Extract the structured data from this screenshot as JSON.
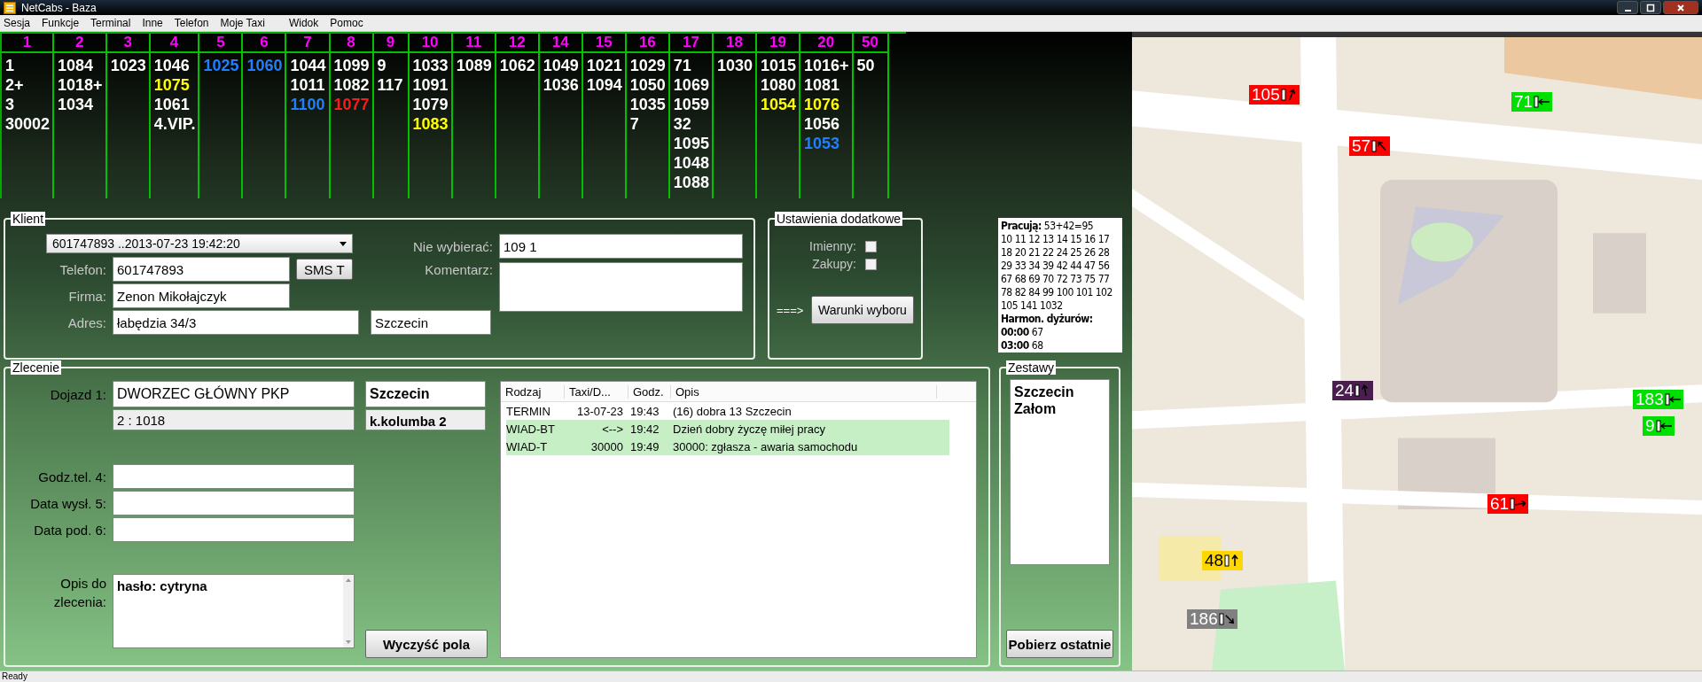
{
  "window": {
    "title": "NetCabs - Baza"
  },
  "menu": [
    "Sesja",
    "Funkcje",
    "Terminal",
    "Inne",
    "Telefon",
    "Moje Taxi",
    "Widok",
    "Pomoc"
  ],
  "queues": [
    {
      "zone": "1",
      "taxis": [
        {
          "text": "1",
          "color": "#ffffff"
        },
        {
          "text": "2+",
          "color": "#ffffff"
        },
        {
          "text": "3",
          "color": "#ffffff"
        },
        {
          "text": "30002",
          "color": "#ffffff"
        }
      ]
    },
    {
      "zone": "2",
      "taxis": [
        {
          "text": "1084",
          "color": "#ffffff"
        },
        {
          "text": "1018+",
          "color": "#ffffff"
        },
        {
          "text": "1034",
          "color": "#ffffff"
        }
      ]
    },
    {
      "zone": "3",
      "taxis": [
        {
          "text": "1023",
          "color": "#ffffff"
        }
      ]
    },
    {
      "zone": "4",
      "taxis": [
        {
          "text": "1046",
          "color": "#ffffff"
        },
        {
          "text": "1075",
          "color": "#ffff00"
        },
        {
          "text": "1061",
          "color": "#ffffff"
        },
        {
          "text": "4.VIP.",
          "color": "#ffffff"
        }
      ]
    },
    {
      "zone": "5",
      "taxis": [
        {
          "text": "1025",
          "color": "#1e7fff"
        }
      ]
    },
    {
      "zone": "6",
      "taxis": [
        {
          "text": "1060",
          "color": "#1e7fff"
        }
      ]
    },
    {
      "zone": "7",
      "taxis": [
        {
          "text": "1044",
          "color": "#ffffff"
        },
        {
          "text": "1011",
          "color": "#ffffff"
        },
        {
          "text": "1100",
          "color": "#1e7fff"
        }
      ]
    },
    {
      "zone": "8",
      "taxis": [
        {
          "text": "1099",
          "color": "#ffffff"
        },
        {
          "text": "1082",
          "color": "#ffffff"
        },
        {
          "text": "1077",
          "color": "#ff1a1a"
        }
      ]
    },
    {
      "zone": "9",
      "taxis": [
        {
          "text": "9",
          "color": "#ffffff"
        },
        {
          "text": "117",
          "color": "#ffffff"
        }
      ]
    },
    {
      "zone": "10",
      "taxis": [
        {
          "text": "1033",
          "color": "#ffffff"
        },
        {
          "text": "1091",
          "color": "#ffffff"
        },
        {
          "text": "1079",
          "color": "#ffffff"
        },
        {
          "text": "1083",
          "color": "#ffff00"
        }
      ]
    },
    {
      "zone": "11",
      "taxis": [
        {
          "text": "1089",
          "color": "#ffffff"
        }
      ]
    },
    {
      "zone": "12",
      "taxis": [
        {
          "text": "1062",
          "color": "#ffffff"
        }
      ]
    },
    {
      "zone": "14",
      "taxis": [
        {
          "text": "1049",
          "color": "#ffffff"
        },
        {
          "text": "1036",
          "color": "#ffffff"
        }
      ]
    },
    {
      "zone": "15",
      "taxis": [
        {
          "text": "1021",
          "color": "#ffffff"
        },
        {
          "text": "1094",
          "color": "#ffffff"
        }
      ]
    },
    {
      "zone": "16",
      "taxis": [
        {
          "text": "1029",
          "color": "#ffffff"
        },
        {
          "text": "1050",
          "color": "#ffffff"
        },
        {
          "text": "1035",
          "color": "#ffffff"
        },
        {
          "text": "7",
          "color": "#ffffff"
        }
      ]
    },
    {
      "zone": "17",
      "taxis": [
        {
          "text": "71",
          "color": "#ffffff"
        },
        {
          "text": "1069",
          "color": "#ffffff"
        },
        {
          "text": "1059",
          "color": "#ffffff"
        },
        {
          "text": "32",
          "color": "#ffffff"
        },
        {
          "text": "1095",
          "color": "#ffffff"
        },
        {
          "text": "1048",
          "color": "#ffffff"
        },
        {
          "text": "1088",
          "color": "#ffffff"
        }
      ]
    },
    {
      "zone": "18",
      "taxis": [
        {
          "text": "1030",
          "color": "#ffffff"
        }
      ]
    },
    {
      "zone": "19",
      "taxis": [
        {
          "text": "1015",
          "color": "#ffffff"
        },
        {
          "text": "1080",
          "color": "#ffffff"
        },
        {
          "text": "1054",
          "color": "#ffff00"
        }
      ]
    },
    {
      "zone": "20",
      "taxis": [
        {
          "text": "1016+",
          "color": "#ffffff"
        },
        {
          "text": "1081",
          "color": "#ffffff"
        },
        {
          "text": "1076",
          "color": "#ffff00"
        },
        {
          "text": "1056",
          "color": "#ffffff"
        },
        {
          "text": "1053",
          "color": "#1e7fff"
        }
      ]
    },
    {
      "zone": "50",
      "taxis": [
        {
          "text": "50",
          "color": "#ffffff"
        }
      ]
    }
  ],
  "client": {
    "title": "Klient",
    "history": "601747893  ..2013-07-23 19:42:20",
    "phone": {
      "label": "Telefon:",
      "value": "601747893",
      "disabled": true
    },
    "sms_button": "SMS  T",
    "company": {
      "label": "Firma:",
      "value": "Zenon Mikołajczyk",
      "disabled": true
    },
    "address": {
      "label": "Adres:",
      "value": "łabędzia 34/3",
      "disabled": true
    },
    "city": "Szczecin",
    "exclude": {
      "label": "Nie wybierać:",
      "value": "109  1",
      "disabled": true
    },
    "comment": {
      "label": "Komentarz:",
      "disabled": true
    }
  },
  "extra_settings": {
    "title": "Ustawienia dodatkowe",
    "options": [
      {
        "label": "Imienny:",
        "checked": false
      },
      {
        "label": "Zakupy:",
        "checked": false
      }
    ],
    "arrow": "===>",
    "button": "Warunki wyboru"
  },
  "working": {
    "heading": "Pracują:",
    "count": "53+42=95",
    "numbers": "10 11 12 13 14 15 16 17 18 20 21 22 24 25 26 28 29 33 34 39 42 44 47 56 67 68 69 70 72 73 75 77 78 82 84 99 100 101 102 105 141 1032",
    "schedule_heading": "Harmon. dyżurów:",
    "schedule": [
      {
        "time": "00:00",
        "taxi": "67"
      },
      {
        "time": "03:00",
        "taxi": "68"
      }
    ]
  },
  "order": {
    "title": "Zlecenie",
    "pickup": {
      "label": "Dojazd 1:",
      "value": "DWORZEC GŁÓWNY PKP",
      "zone": "2 : 1018",
      "city": "Szczecin",
      "note": "k.kolumba 2"
    },
    "fields": [
      {
        "label": "Godz.tel. 4:"
      },
      {
        "label": "Data wysł. 5:"
      },
      {
        "label": "Data pod. 6:"
      }
    ],
    "description": {
      "label": "Opis do zlecenia:",
      "value": "hasło: cytryna"
    },
    "clear_button": "Wyczyść pola",
    "table": {
      "columns": [
        "Rodzaj",
        "Taxi/D...",
        "Godz.",
        "Opis"
      ],
      "rows": [
        {
          "cells": [
            "TERMIN",
            "13-07-23",
            "19:43",
            "(16) dobra 13 Szczecin"
          ],
          "selected": false
        },
        {
          "cells": [
            "WIAD-BT",
            "<-->",
            "19:42",
            "Dzień dobry życzę miłej pracy"
          ],
          "selected": true
        },
        {
          "cells": [
            "WIAD-T",
            "30000",
            "19:49",
            "30000: zgłasza - awaria samochodu"
          ],
          "selected": true
        }
      ]
    }
  },
  "sets": {
    "title": "Zestawy",
    "items": [
      "Szczecin",
      "Załom"
    ],
    "button": "Pobierz ostatnie"
  },
  "map": {
    "kind": "picture",
    "vehicles": [
      {
        "number": "105",
        "color": "#ff0000"
      },
      {
        "number": "71",
        "color": "#00e000"
      },
      {
        "number": "57",
        "color": "#ff0000"
      },
      {
        "number": "24",
        "color": "#4a1f4f"
      },
      {
        "number": "183",
        "color": "#00e000"
      },
      {
        "number": "9",
        "color": "#00e000"
      },
      {
        "number": "61",
        "color": "#ff0000"
      },
      {
        "number": "48",
        "color": "#ffd700"
      },
      {
        "number": "186",
        "color": "#808080"
      }
    ]
  },
  "status_bar": "Ready"
}
